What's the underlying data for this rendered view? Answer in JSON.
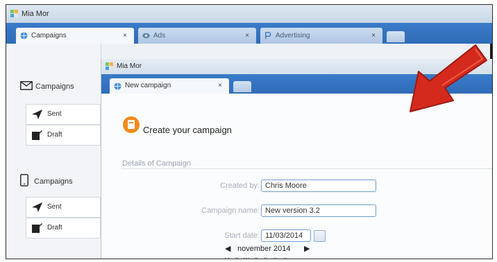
{
  "window": {
    "title": "Mia Mor"
  },
  "tabs": [
    {
      "label": "Campaigns",
      "close": "×",
      "icon": "globe-icon"
    },
    {
      "label": "Ads",
      "close": "×",
      "icon": "ad-icon"
    },
    {
      "label": "Advertising",
      "close": "×",
      "icon": "p-icon"
    }
  ],
  "sidebar": {
    "groups": [
      {
        "heading": "Campaigns",
        "icon": "envelope-icon",
        "items": [
          {
            "label": "Sent",
            "icon": "send-icon"
          },
          {
            "label": "Draft",
            "icon": "draft-icon"
          }
        ]
      },
      {
        "heading": "Campaigns",
        "icon": "phone-icon",
        "items": [
          {
            "label": "Sent",
            "icon": "send-icon"
          },
          {
            "label": "Draft",
            "icon": "draft-icon"
          }
        ]
      }
    ]
  },
  "inner": {
    "title": "Mia Mor",
    "tab": {
      "label": "New campaign",
      "close": "×"
    },
    "heading": "Create your campaign",
    "section": "Details of Campaign",
    "form": {
      "created_by_label": "Created by:",
      "created_by_value": "Chris Moore",
      "name_label": "Campaign name:",
      "name_value": "New version 3.2",
      "start_label": "Start date:",
      "start_value": "11/03/2014"
    },
    "calendar": {
      "month": "november 2014",
      "prev": "◀",
      "next": "▶",
      "weekdays": [
        "M",
        "T",
        "W",
        "T",
        "F",
        "S",
        "S"
      ]
    }
  },
  "colors": {
    "accent": "#2f6cb8",
    "arrow": "#d42a1d",
    "brand_orange": "#f28a1c"
  }
}
